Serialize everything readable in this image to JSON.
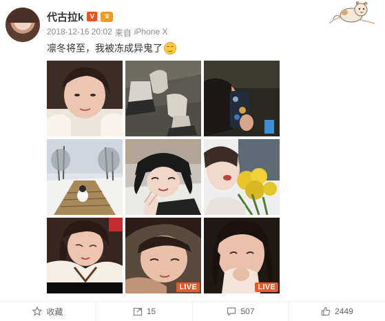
{
  "post": {
    "username": "代古拉k",
    "vip_badge": "V",
    "member_badge": "♛",
    "timestamp": "2018-12-16 20:02",
    "source_prefix": "来自",
    "source_device": "iPhone X",
    "text": "凛冬将至，我被冻成异鬼了",
    "emoji": "grin-emoji"
  },
  "photos": [
    {
      "id": "photo-1",
      "live": false
    },
    {
      "id": "photo-2",
      "live": false
    },
    {
      "id": "photo-3",
      "live": false
    },
    {
      "id": "photo-4",
      "live": false
    },
    {
      "id": "photo-5",
      "live": false
    },
    {
      "id": "photo-6",
      "live": false
    },
    {
      "id": "photo-7",
      "live": false
    },
    {
      "id": "photo-8",
      "live": true
    },
    {
      "id": "photo-9",
      "live": true
    }
  ],
  "live_label": "LIVE",
  "actions": {
    "favorite": {
      "icon": "star-icon",
      "label": "收藏"
    },
    "repost": {
      "icon": "repost-icon",
      "count": "15"
    },
    "comment": {
      "icon": "comment-icon",
      "count": "507"
    },
    "like": {
      "icon": "thumbs-up-icon",
      "count": "2449"
    }
  },
  "colors": {
    "accent": "#e9572c",
    "text": "#333333",
    "meta": "#8a8a8a",
    "vip": "#e8541e"
  }
}
